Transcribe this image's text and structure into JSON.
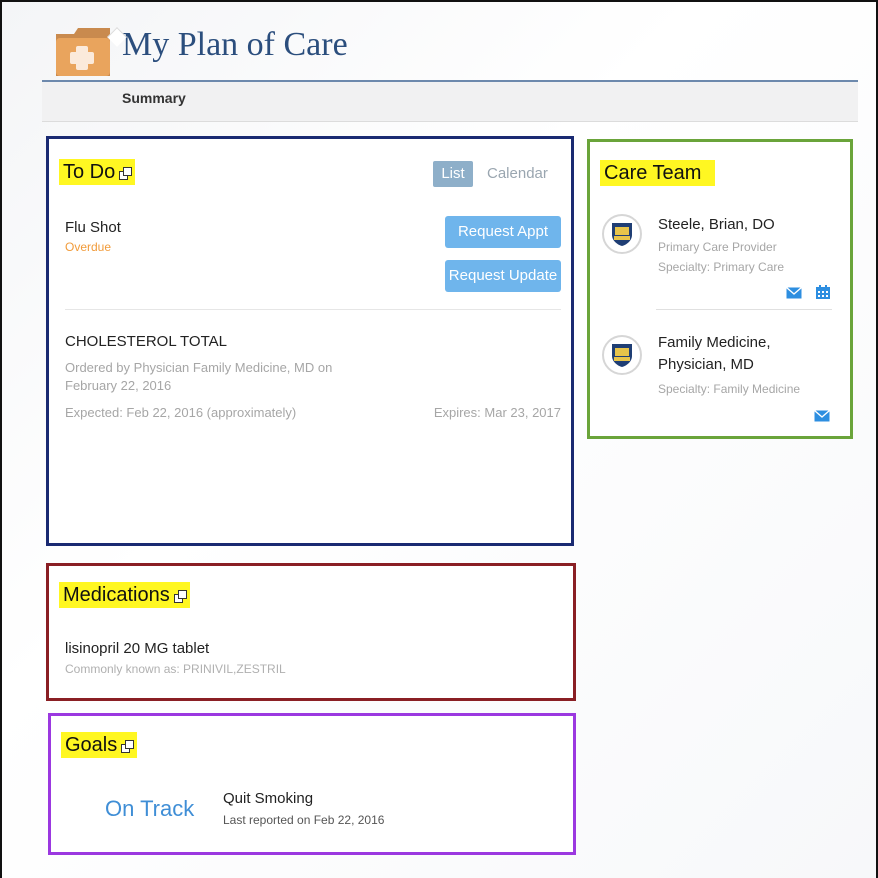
{
  "header": {
    "title": "My Plan of Care",
    "icon": "medical-folder-icon"
  },
  "subnav": {
    "tabs": [
      {
        "label": "Summary",
        "active": true
      }
    ]
  },
  "todo": {
    "title": "To Do",
    "view_toggle": {
      "list": "List",
      "calendar": "Calendar",
      "selected": "List"
    },
    "items": [
      {
        "title": "Flu Shot",
        "status": "Overdue",
        "status_color": "#f19b3a",
        "buttons": [
          "Request Appt",
          "Request Update"
        ]
      },
      {
        "title": "CHOLESTEROL TOTAL",
        "ordered_by": "Ordered by Physician Family Medicine, MD on February 22, 2016",
        "expected": "Expected: Feb 22, 2016 (approximately)",
        "expires": "Expires: Mar 23, 2017"
      }
    ]
  },
  "care_team": {
    "title": "Care Team",
    "members": [
      {
        "name": "Steele, Brian, DO",
        "role": "Primary Care Provider",
        "specialty": "Specialty: Primary Care",
        "actions": [
          "mail-icon",
          "calendar-icon"
        ]
      },
      {
        "name": "Family Medicine, Physician, MD",
        "role": "",
        "specialty": "Specialty: Family Medicine",
        "actions": [
          "mail-icon"
        ]
      }
    ]
  },
  "medications": {
    "title": "Medications",
    "items": [
      {
        "name": "lisinopril 20 MG tablet",
        "aka": "Commonly known as: PRINIVIL,ZESTRIL"
      }
    ]
  },
  "goals": {
    "title": "Goals",
    "items": [
      {
        "status": "On Track",
        "name": "Quit Smoking",
        "last_reported": "Last reported on Feb 22, 2016"
      }
    ]
  },
  "colors": {
    "title_blue": "#2b4e7d",
    "button_blue": "#6fb5ec",
    "highlight": "#fff722",
    "todo_border": "#1a2a72",
    "care_border": "#6aa43a",
    "meds_border": "#8a1f24",
    "goals_border": "#9b38e0"
  }
}
